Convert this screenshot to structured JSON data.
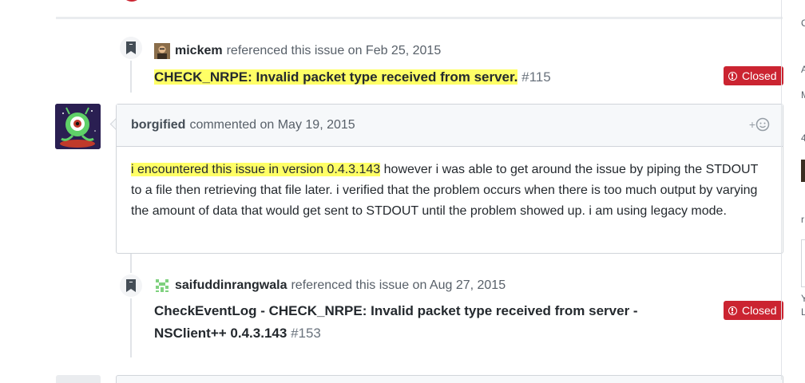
{
  "events": [
    {
      "actor": "mickem",
      "action": "referenced this issue on Feb 25, 2015",
      "title": "CHECK_NRPE: Invalid packet type received from server.",
      "number": "#115",
      "state": "Closed"
    },
    {
      "actor": "saifuddinrangwala",
      "action": "referenced this issue on Aug 27, 2015",
      "title_line1": "CheckEventLog - CHECK_NRPE: Invalid packet type received from server -",
      "title_line2": "NSClient++ 0.4.3.143",
      "number": "#153",
      "state": "Closed"
    }
  ],
  "comment": {
    "author": "borgified",
    "meta": "commented on May 19, 2015",
    "reaction": "+",
    "body_highlight": "i encountered this issue in version 0.4.3.143",
    "body_rest": " however i was able to get around the issue by piping the STDOUT to a file then retrieving that file later. i verified that the problem occurs when there is too much output by varying the amount of data that would get sent to STDOUT until the problem showed up. i am using legacy mode."
  },
  "sidebar_fragments": [
    "C",
    "A",
    "M",
    "4",
    "r",
    "Y",
    "L"
  ],
  "colors": {
    "closed": "#cb2431",
    "highlight": "#ffff66"
  },
  "icons": [
    "bookmark-icon",
    "alert-icon",
    "smiley-icon"
  ]
}
